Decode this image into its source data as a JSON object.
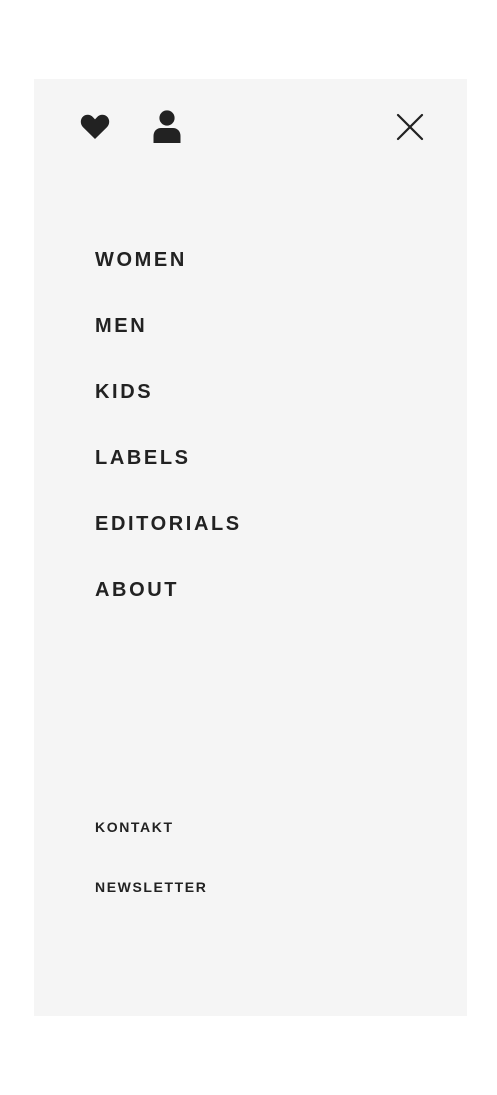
{
  "header": {
    "wishlist_icon": "heart-icon",
    "account_icon": "user-icon",
    "close_icon": "close-icon"
  },
  "main_nav": {
    "items": [
      "WOMEN",
      "MEN",
      "KIDS",
      "LABELS",
      "EDITORIALS",
      "ABOUT"
    ]
  },
  "footer_nav": {
    "items": [
      "KONTAKT",
      "NEWSLETTER"
    ]
  },
  "colors": {
    "panel_background": "#f5f5f5",
    "text": "#222222",
    "page_background": "#ffffff"
  }
}
